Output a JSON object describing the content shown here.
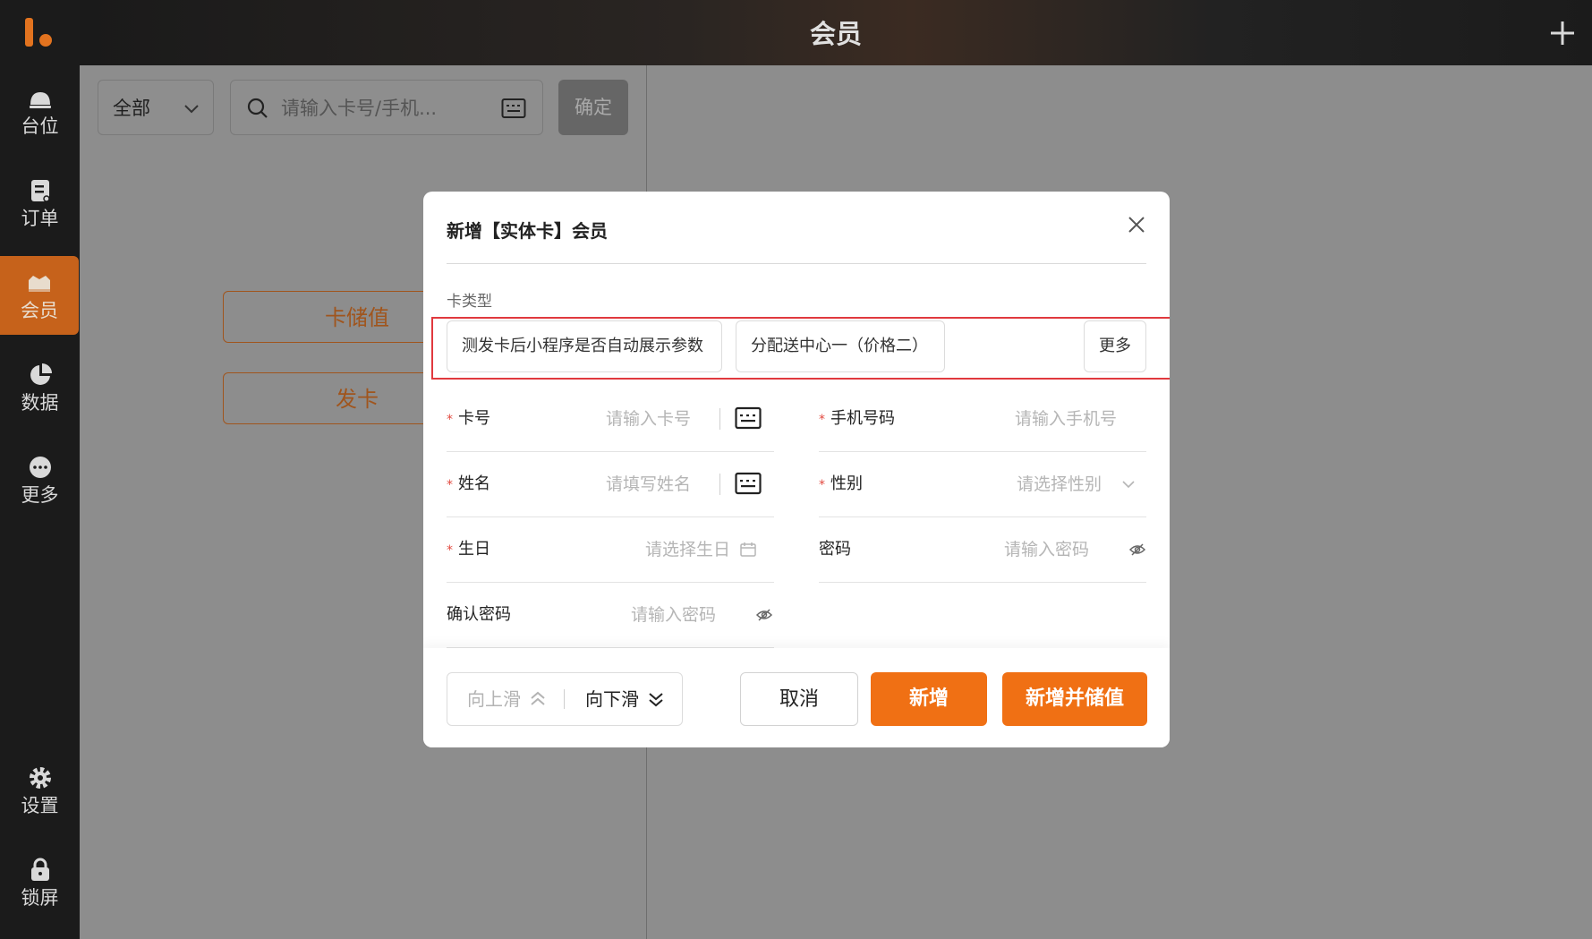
{
  "header": {
    "title": "会员"
  },
  "sidebar": {
    "items": [
      {
        "label": "台位",
        "icon": "bell-icon"
      },
      {
        "label": "订单",
        "icon": "order-icon"
      },
      {
        "label": "会员",
        "icon": "member-icon",
        "active": true
      },
      {
        "label": "数据",
        "icon": "pie-chart-icon"
      },
      {
        "label": "更多",
        "icon": "more-icon"
      },
      {
        "label": "设置",
        "icon": "gear-icon"
      },
      {
        "label": "锁屏",
        "icon": "lock-icon"
      }
    ]
  },
  "left_panel": {
    "filter": {
      "selected": "全部"
    },
    "search": {
      "placeholder": "请输入卡号/手机..."
    },
    "confirm_label": "确定",
    "recharge_label": "卡储值",
    "issue_card_label": "发卡"
  },
  "modal": {
    "title": "新增【实体卡】会员",
    "card_type_label": "卡类型",
    "card_types": [
      "测发卡后小程序是否自动展示参数",
      "分配送中心一（价格二）"
    ],
    "more_label": "更多",
    "fields": {
      "card_no": {
        "label": "卡号",
        "placeholder": "请输入卡号",
        "required": true
      },
      "phone": {
        "label": "手机号码",
        "placeholder": "请输入手机号",
        "required": true
      },
      "name": {
        "label": "姓名",
        "placeholder": "请填写姓名",
        "required": true
      },
      "gender": {
        "label": "性别",
        "placeholder": "请选择性别",
        "required": true
      },
      "birthday": {
        "label": "生日",
        "placeholder": "请选择生日",
        "required": true
      },
      "password": {
        "label": "密码",
        "placeholder": "请输入密码",
        "required": false
      },
      "confirm_password": {
        "label": "确认密码",
        "placeholder": "请输入密码",
        "required": false
      }
    },
    "footer": {
      "scroll_up": "向上滑",
      "scroll_down": "向下滑",
      "cancel": "取消",
      "add": "新增",
      "add_and_charge": "新增并储值"
    }
  },
  "colors": {
    "accent": "#f07014",
    "sidebar_active": "#c6621b",
    "required": "#e24a40",
    "highlight_frame": "#e0393e"
  }
}
